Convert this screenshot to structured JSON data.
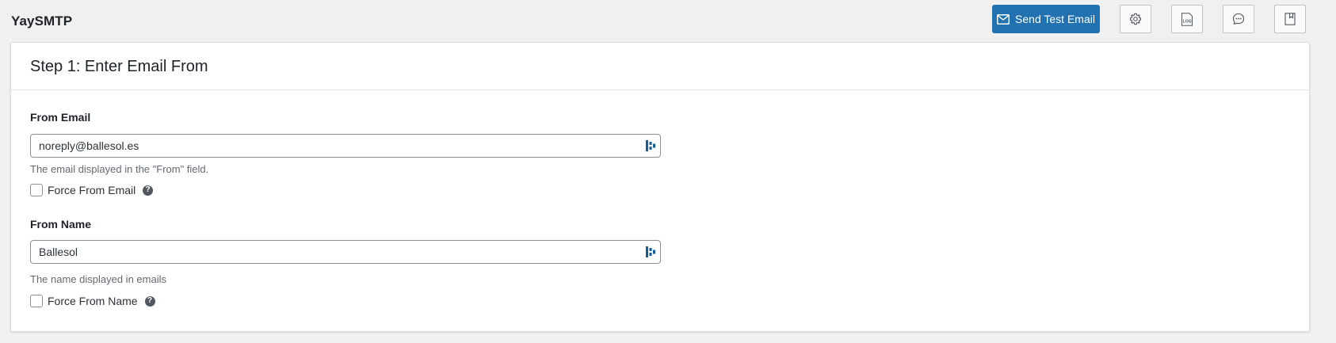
{
  "app": {
    "title": "YaySMTP"
  },
  "toolbar": {
    "send_test_email_label": "Send Test Email",
    "icons": [
      "settings-gear-icon",
      "log-icon",
      "chat-bubble-icon",
      "document-icon"
    ],
    "log_icon_text": "LOG"
  },
  "colors": {
    "primary": "#2271b1",
    "background": "#f0f0f1",
    "card_bg": "#ffffff",
    "input_icon": "#135e96"
  },
  "step": {
    "title": "Step 1: Enter Email From",
    "from_email": {
      "label": "From Email",
      "value": "noreply@ballesol.es",
      "help": "The email displayed in the \"From\" field.",
      "force_label": "Force From Email",
      "force_checked": false
    },
    "from_name": {
      "label": "From Name",
      "value": "Ballesol",
      "help": "The name displayed in emails",
      "force_label": "Force From Name",
      "force_checked": false
    }
  }
}
